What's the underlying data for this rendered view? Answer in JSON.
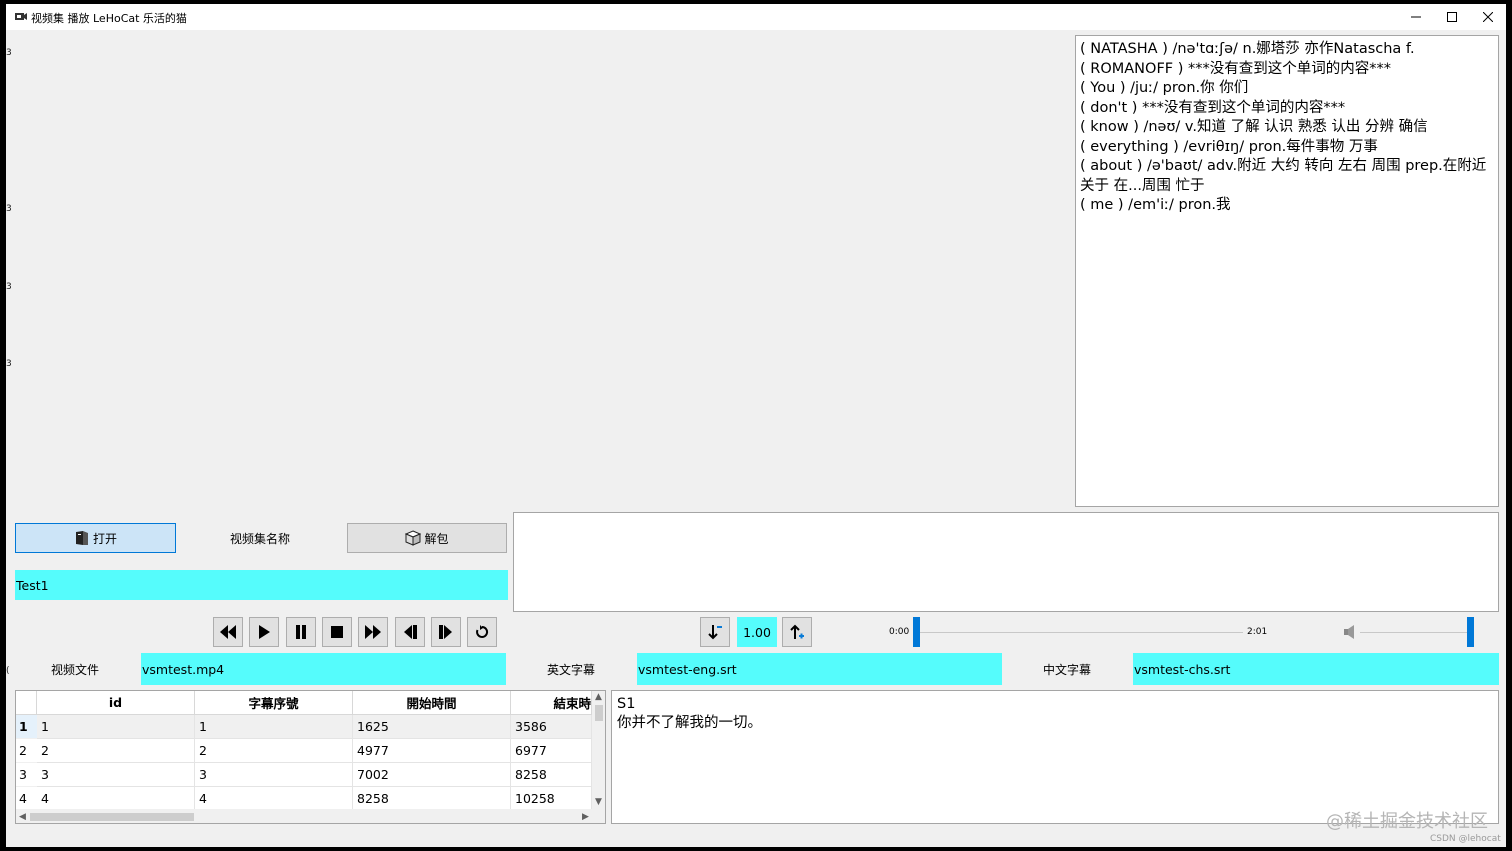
{
  "window": {
    "title": "视频集 播放  LeHoCat 乐活的猫",
    "controls": [
      "minimize",
      "maximize",
      "close"
    ]
  },
  "left_edge_marks": [
    "3",
    "3",
    "3",
    "3",
    "("
  ],
  "dictionary": {
    "lines": [
      "( NATASHA ) /nə'tɑːʃə/  n.娜塔莎 亦作Natascha f.",
      "( ROMANOFF ) ***没有查到这个单词的内容***",
      "( You ) /juː/  pron.你 你们",
      "( don't ) ***没有查到这个单词的内容***",
      "( know ) /nəʊ/  v.知道 了解 认识 熟悉 认出 分辨 确信",
      "( everything ) /evriθɪŋ/  pron.每件事物 万事",
      "( about ) /ə'baʊt/  adv.附近 大约 转向 左右 周围 prep.在附近 关于 在...周围 忙于",
      "( me ) /em'iː/  pron.我"
    ]
  },
  "open_button": {
    "label": "打开"
  },
  "collection_label": "视频集名称",
  "unpack_button": {
    "label": "解包"
  },
  "collection_name": "Test1",
  "player": {
    "rate": "1.00",
    "time_start": "0:00",
    "time_end": "2:01",
    "progress": 0.0,
    "volume": 1.0
  },
  "files": {
    "video_label": "视频文件",
    "video_value": "vsmtest.mp4",
    "eng_label": "英文字幕",
    "eng_value": "vsmtest-eng.srt",
    "chs_label": "中文字幕",
    "chs_value": "vsmtest-chs.srt"
  },
  "table": {
    "columns": [
      "id",
      "字幕序號",
      "開始時間",
      "結束時"
    ],
    "rows": [
      {
        "head": "1",
        "cells": [
          "1",
          "1",
          "1625",
          "3586"
        ]
      },
      {
        "head": "2",
        "cells": [
          "2",
          "2",
          "4977",
          "6977"
        ]
      },
      {
        "head": "3",
        "cells": [
          "3",
          "3",
          "7002",
          "8258"
        ]
      },
      {
        "head": "4",
        "cells": [
          "4",
          "4",
          "8258",
          "10258"
        ]
      }
    ]
  },
  "subtitle_text": {
    "line1": "S1",
    "line2": "你并不了解我的一切。"
  },
  "watermark": "@稀土掘金技术社区",
  "watermark_small": "CSDN @lehocat"
}
